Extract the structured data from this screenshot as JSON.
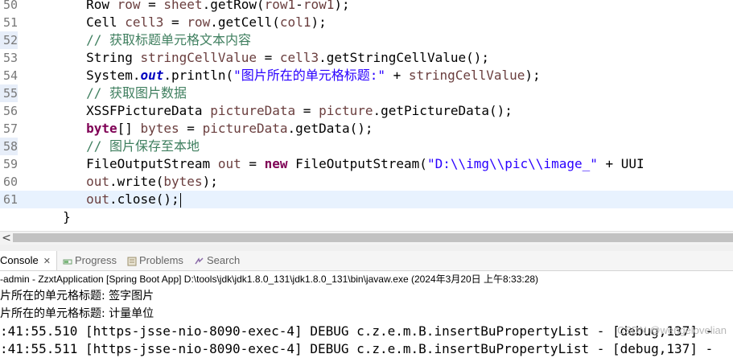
{
  "editor": {
    "lines": [
      {
        "num": "50",
        "segments": [
          {
            "t": "        ",
            "c": ""
          },
          {
            "t": "Row ",
            "c": ""
          },
          {
            "t": "row",
            "c": "vr"
          },
          {
            "t": " = ",
            "c": ""
          },
          {
            "t": "sheet",
            "c": "vr"
          },
          {
            "t": ".getRow(",
            "c": ""
          },
          {
            "t": "row1",
            "c": "vr"
          },
          {
            "t": "-",
            "c": ""
          },
          {
            "t": "row1",
            "c": "vr"
          },
          {
            "t": ");",
            "c": ""
          }
        ]
      },
      {
        "num": "51",
        "segments": [
          {
            "t": "        ",
            "c": ""
          },
          {
            "t": "Cell ",
            "c": ""
          },
          {
            "t": "cell3",
            "c": "vr"
          },
          {
            "t": " = ",
            "c": ""
          },
          {
            "t": "row",
            "c": "vr"
          },
          {
            "t": ".getCell(",
            "c": ""
          },
          {
            "t": "col1",
            "c": "vr"
          },
          {
            "t": ");",
            "c": ""
          }
        ]
      },
      {
        "num": "52",
        "segments": [
          {
            "t": "        ",
            "c": ""
          },
          {
            "t": "// 获取标题单元格文本内容",
            "c": "cm"
          }
        ]
      },
      {
        "num": "53",
        "segments": [
          {
            "t": "        ",
            "c": ""
          },
          {
            "t": "String ",
            "c": ""
          },
          {
            "t": "stringCellValue",
            "c": "vr"
          },
          {
            "t": " = ",
            "c": ""
          },
          {
            "t": "cell3",
            "c": "vr"
          },
          {
            "t": ".getStringCellValue();",
            "c": ""
          }
        ]
      },
      {
        "num": "54",
        "segments": [
          {
            "t": "        ",
            "c": ""
          },
          {
            "t": "System.",
            "c": ""
          },
          {
            "t": "out",
            "c": "fld"
          },
          {
            "t": ".println(",
            "c": ""
          },
          {
            "t": "\"图片所在的单元格标题:\"",
            "c": "st"
          },
          {
            "t": " + ",
            "c": ""
          },
          {
            "t": "stringCellValue",
            "c": "vr"
          },
          {
            "t": ");",
            "c": ""
          }
        ]
      },
      {
        "num": "55",
        "segments": [
          {
            "t": "        ",
            "c": ""
          },
          {
            "t": "// 获取图片数据",
            "c": "cm"
          }
        ]
      },
      {
        "num": "56",
        "segments": [
          {
            "t": "        ",
            "c": ""
          },
          {
            "t": "XSSFPictureData ",
            "c": ""
          },
          {
            "t": "pictureData",
            "c": "vr"
          },
          {
            "t": " = ",
            "c": ""
          },
          {
            "t": "picture",
            "c": "vr"
          },
          {
            "t": ".getPictureData();",
            "c": ""
          }
        ]
      },
      {
        "num": "57",
        "segments": [
          {
            "t": "        ",
            "c": ""
          },
          {
            "t": "byte",
            "c": "kw"
          },
          {
            "t": "[] ",
            "c": ""
          },
          {
            "t": "bytes",
            "c": "vr"
          },
          {
            "t": " = ",
            "c": ""
          },
          {
            "t": "pictureData",
            "c": "vr"
          },
          {
            "t": ".getData();",
            "c": ""
          }
        ]
      },
      {
        "num": "58",
        "segments": [
          {
            "t": "        ",
            "c": ""
          },
          {
            "t": "// 图片保存至本地",
            "c": "cm"
          }
        ]
      },
      {
        "num": "59",
        "segments": [
          {
            "t": "        ",
            "c": ""
          },
          {
            "t": "FileOutputStream ",
            "c": ""
          },
          {
            "t": "out",
            "c": "vr"
          },
          {
            "t": " = ",
            "c": ""
          },
          {
            "t": "new",
            "c": "kw"
          },
          {
            "t": " FileOutputStream(",
            "c": ""
          },
          {
            "t": "\"D:\\\\img\\\\pic\\\\image_\"",
            "c": "st"
          },
          {
            "t": " + UUI",
            "c": ""
          }
        ]
      },
      {
        "num": "60",
        "segments": [
          {
            "t": "        ",
            "c": ""
          },
          {
            "t": "out",
            "c": "vr"
          },
          {
            "t": ".write(",
            "c": ""
          },
          {
            "t": "bytes",
            "c": "vr"
          },
          {
            "t": ");",
            "c": ""
          }
        ]
      },
      {
        "num": "61",
        "segments": [
          {
            "t": "        ",
            "c": ""
          },
          {
            "t": "out",
            "c": "vr"
          },
          {
            "t": ".close();",
            "c": ""
          }
        ]
      },
      {
        "num": "",
        "segments": [
          {
            "t": "     }",
            "c": ""
          }
        ]
      }
    ],
    "current_line_index": 11,
    "breakpoint_marked": [
      "52",
      "55",
      "58"
    ]
  },
  "scrollbar": {
    "left_arrow": "<"
  },
  "tabs": [
    {
      "label": "Console",
      "active": true,
      "close": "✕"
    },
    {
      "label": "Progress",
      "active": false
    },
    {
      "label": "Problems",
      "active": false
    },
    {
      "label": "Search",
      "active": false
    }
  ],
  "process_label": "-admin - ZzxtApplication [Spring Boot App] D:\\tools\\jdk\\jdk1.8.0_131\\jdk1.8.0_131\\bin\\javaw.exe (2024年3月20日 上午8:33:28)",
  "console_lines": [
    {
      "text": "片所在的单元格标题: 签字图片",
      "kind": "cn"
    },
    {
      "text": "片所在的单元格标题: 计量单位",
      "kind": "cn"
    },
    {
      "text": ":41:55.510 [https-jsse-nio-8090-exec-4] DEBUG c.z.e.m.B.insertBuPropertyList - [debug,137] -",
      "kind": "log"
    },
    {
      "text": ":41:55.511 [https-jsse-nio-8090-exec-4] DEBUG c.z.e.m.B.insertBuPropertyList - [debug,137] -",
      "kind": "log"
    }
  ],
  "watermark": "CSDN @wengelovelian",
  "colors": {
    "keyword": "#7f0055",
    "comment": "#3f7f5f",
    "string": "#2a00ff",
    "field": "#0000c0",
    "current_line": "#e8f2fe"
  }
}
